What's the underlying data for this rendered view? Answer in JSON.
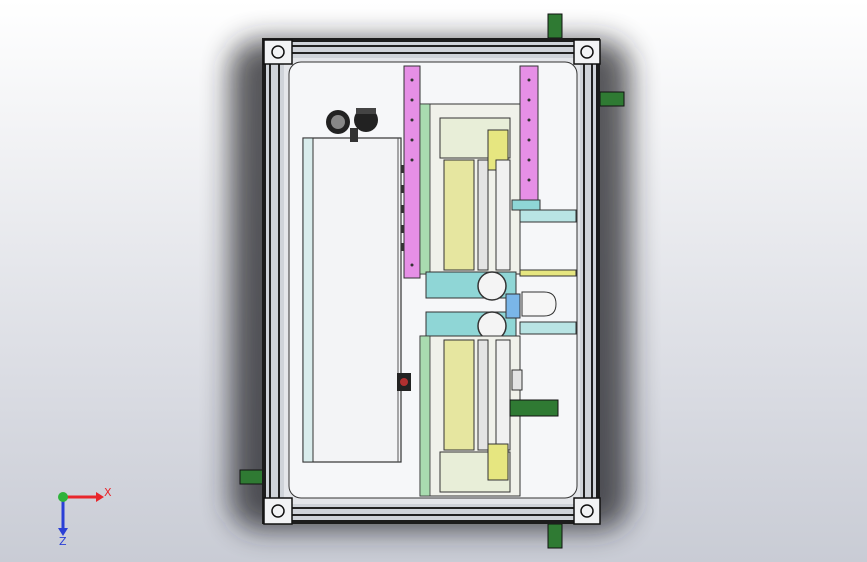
{
  "triad": {
    "x_label": "X",
    "z_label": "Z",
    "x_color": "#e8262b",
    "y_color": "#2fb33a",
    "z_color": "#2a3fd6"
  },
  "colors": {
    "frame": "#1a1a1a",
    "rail_silver": "#d8dce2",
    "foot": "#2f7a33",
    "magenta": "#e68fe6",
    "green_plate": "#a9dcb0",
    "cyan": "#8fd6d6",
    "yellow": "#e6e680",
    "blue_part": "#7ab6e8"
  }
}
